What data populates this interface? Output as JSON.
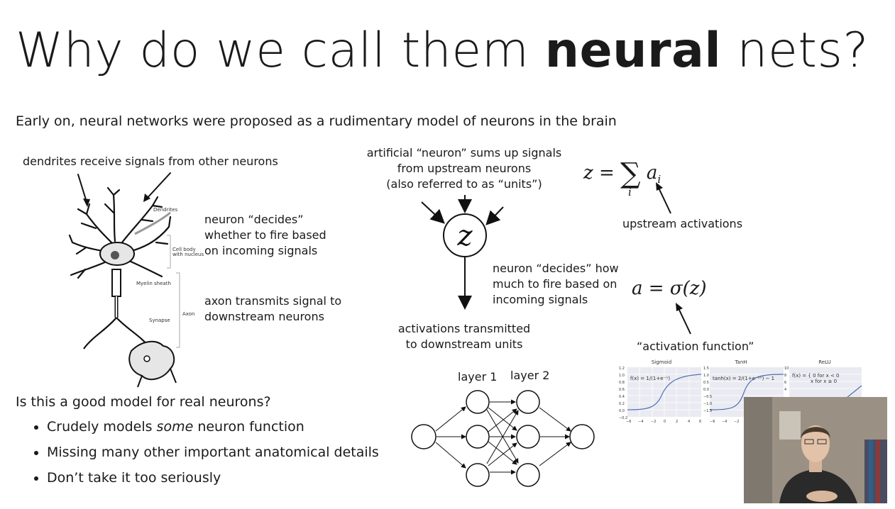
{
  "slide": {
    "title_prefix": "Why do we call them ",
    "title_bold": "neural",
    "title_suffix": " nets?",
    "subtitle": "Early on, neural networks were proposed as a rudimentary model of neurons in the brain"
  },
  "biology": {
    "dendrites_label": "dendrites receive signals from other neurons",
    "decides_line1": "neuron “decides”",
    "decides_line2": "whether to fire based",
    "decides_line3": "on incoming signals",
    "axon_line1": "axon transmits signal to",
    "axon_line2": "downstream neurons",
    "diagram_labels": {
      "dendrites": "Dendrites",
      "cell_body_1": "Cell body",
      "cell_body_2": "with nucleus",
      "myelin": "Myelin sheath",
      "axon": "Axon",
      "synapse": "Synapse"
    }
  },
  "artificial": {
    "sum_line1": "artificial “neuron” sums up signals",
    "sum_line2": "from upstream neurons",
    "sum_line3": "(also referred to as “units”)",
    "node_symbol": "z",
    "decides_line1": "neuron “decides” how",
    "decides_line2": "much to fire based on",
    "decides_line3": "incoming signals",
    "transmit_line1": "activations transmitted",
    "transmit_line2": "to downstream units"
  },
  "equations": {
    "sum_lhs": "z =",
    "sum_symbol": "∑",
    "sum_term": "a",
    "sum_term_sub": "i",
    "sum_index": "i",
    "upstream_label": "upstream activations",
    "activation_eq": "a = σ(z)",
    "activation_label": "“activation function”"
  },
  "network": {
    "layer1": "layer 1",
    "layer2": "layer 2"
  },
  "activation_plots": {
    "sigmoid": {
      "name": "Sigmoid",
      "formula": "f(x) = 1/(1+e⁻ˣ)",
      "yticks": [
        "1.2",
        "1.0",
        "0.8",
        "0.6",
        "0.4",
        "0.2",
        "0.0",
        "−0.2"
      ],
      "xticks": [
        "−6",
        "−4",
        "−2",
        "0",
        "2",
        "4",
        "6"
      ]
    },
    "tanh": {
      "name": "TanH",
      "formula": "tanh(x) = 2/(1+e⁻²ˣ) − 1",
      "yticks": [
        "1.5",
        "1.0",
        "0.5",
        "0.0",
        "−0.5",
        "−1.0",
        "−1.5"
      ],
      "xticks": [
        "−6",
        "−4",
        "−2"
      ]
    },
    "relu": {
      "name": "ReLU",
      "formula_line1": "f(x) = { 0  for  x < 0",
      "formula_line2": "x  for  x ≥ 0",
      "yticks": [
        "10",
        "8",
        "6",
        "4"
      ]
    }
  },
  "discussion": {
    "question": "Is this a good model for real neurons?",
    "bullet1_prefix": "Crudely models ",
    "bullet1_em": "some",
    "bullet1_suffix": " neuron function",
    "bullet2": "Missing many other important anatomical details",
    "bullet3": "Don’t take it too seriously"
  },
  "colors": {
    "text": "#1a1a1a",
    "curve": "#4c72b0",
    "node_stroke": "#222222"
  }
}
